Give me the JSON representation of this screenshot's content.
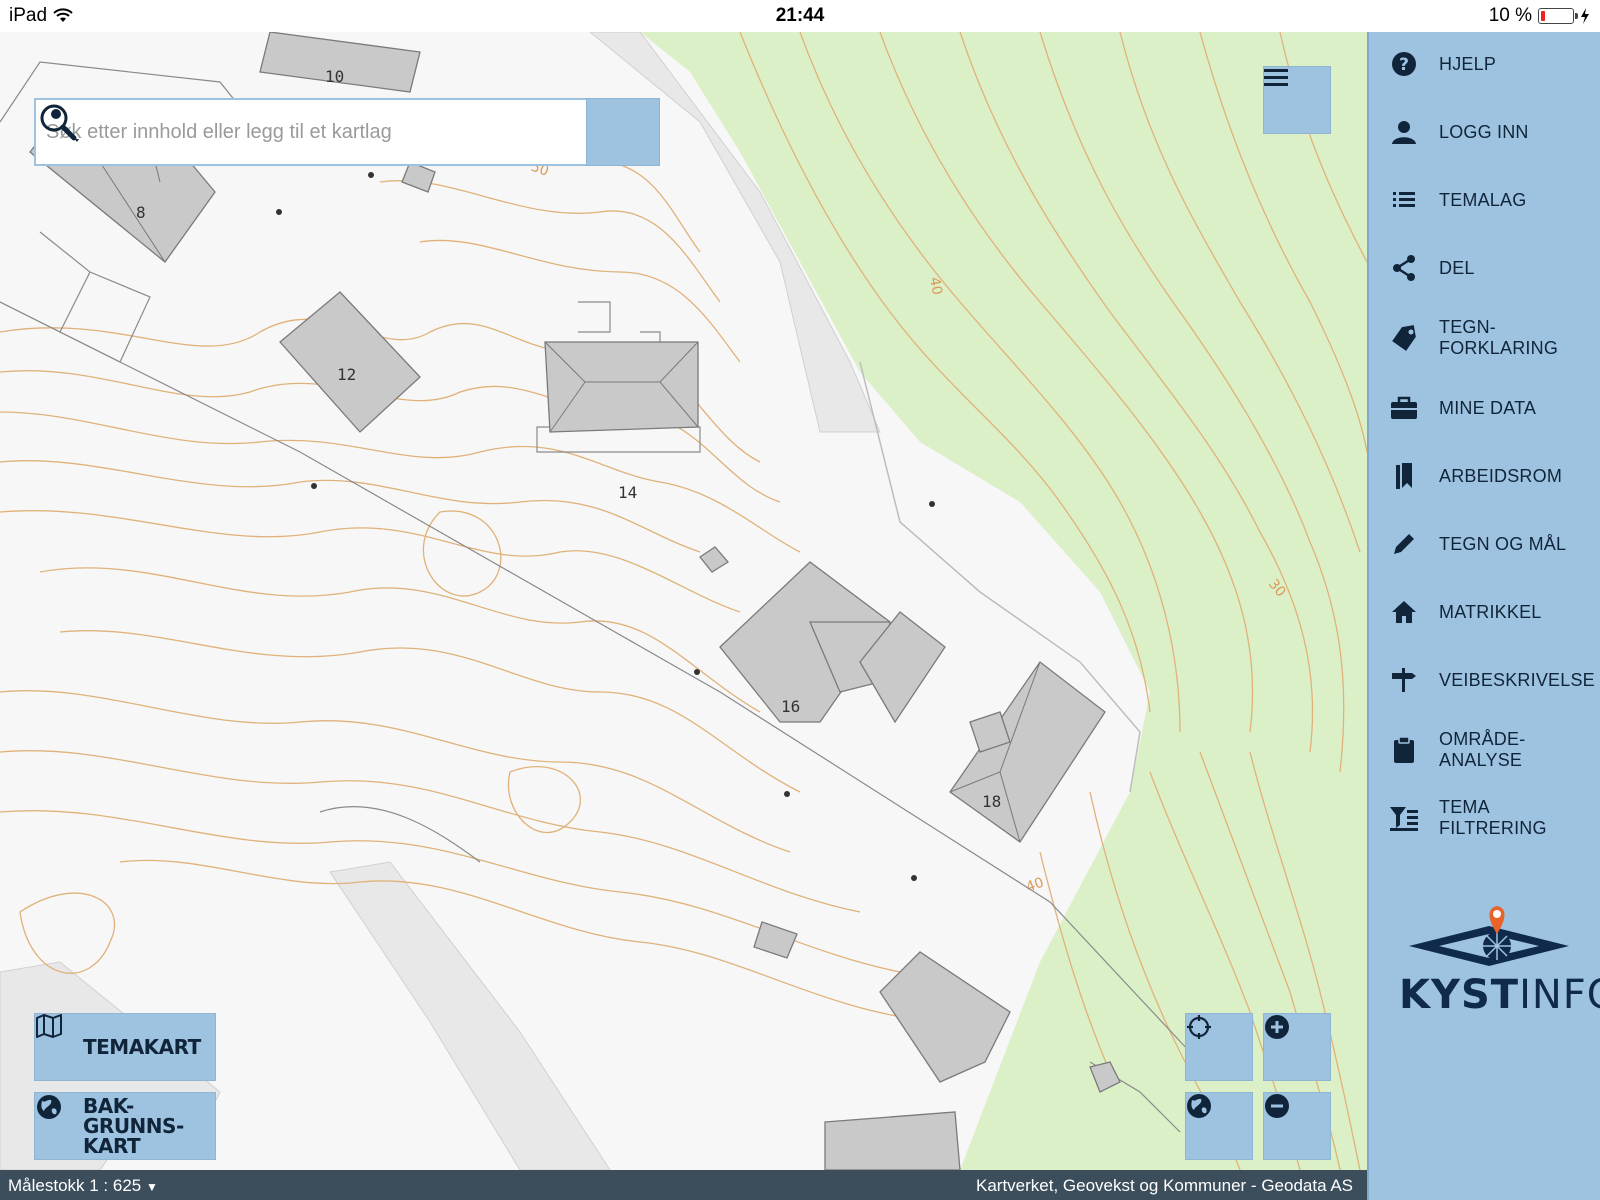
{
  "status": {
    "device": "iPad",
    "time": "21:44",
    "battery": "10 %",
    "battery_level": 0.1
  },
  "search": {
    "placeholder": "Søk etter innhold eller legg til et kartlag"
  },
  "sidebar": {
    "items": [
      {
        "label": "HJELP",
        "icon": "help-icon"
      },
      {
        "label": "LOGG INN",
        "icon": "user-icon"
      },
      {
        "label": "TEMALAG",
        "icon": "list-icon"
      },
      {
        "label": "DEL",
        "icon": "share-icon"
      },
      {
        "label": "TEGN-\nFORKLARING",
        "icon": "tag-icon"
      },
      {
        "label": "MINE DATA",
        "icon": "briefcase-icon"
      },
      {
        "label": "ARBEIDSROM",
        "icon": "bookmark-icon"
      },
      {
        "label": "TEGN OG MÅL",
        "icon": "pencil-icon"
      },
      {
        "label": "MATRIKKEL",
        "icon": "home-icon"
      },
      {
        "label": "VEIBESKRIVELSE",
        "icon": "signpost-icon"
      },
      {
        "label": "OMRÅDE-\nANALYSE",
        "icon": "clipboard-icon"
      },
      {
        "label": "TEMA\nFILTRERING",
        "icon": "filter-icon"
      }
    ],
    "logo_text_light": "KYST",
    "logo_text_bold": "INFO"
  },
  "map": {
    "house_numbers": [
      "10",
      "8",
      "12",
      "14",
      "16",
      "18"
    ],
    "contour_labels": [
      "50",
      "50",
      "40",
      "30",
      "40"
    ],
    "colors": {
      "land": "#f7f7f7",
      "forest": "#dcf0c8",
      "contour": "#e0b27a",
      "building": "#c8c8c8",
      "road": "#e6e6e6"
    }
  },
  "buttons": {
    "temakart": "TEMAKART",
    "bakgrunnskart": "BAK-\nGRUNNS-\nKART"
  },
  "bottombar": {
    "scale": "Målestokk 1 : 625",
    "attribution": "Kartverket, Geovekst og Kommuner - Geodata AS"
  }
}
